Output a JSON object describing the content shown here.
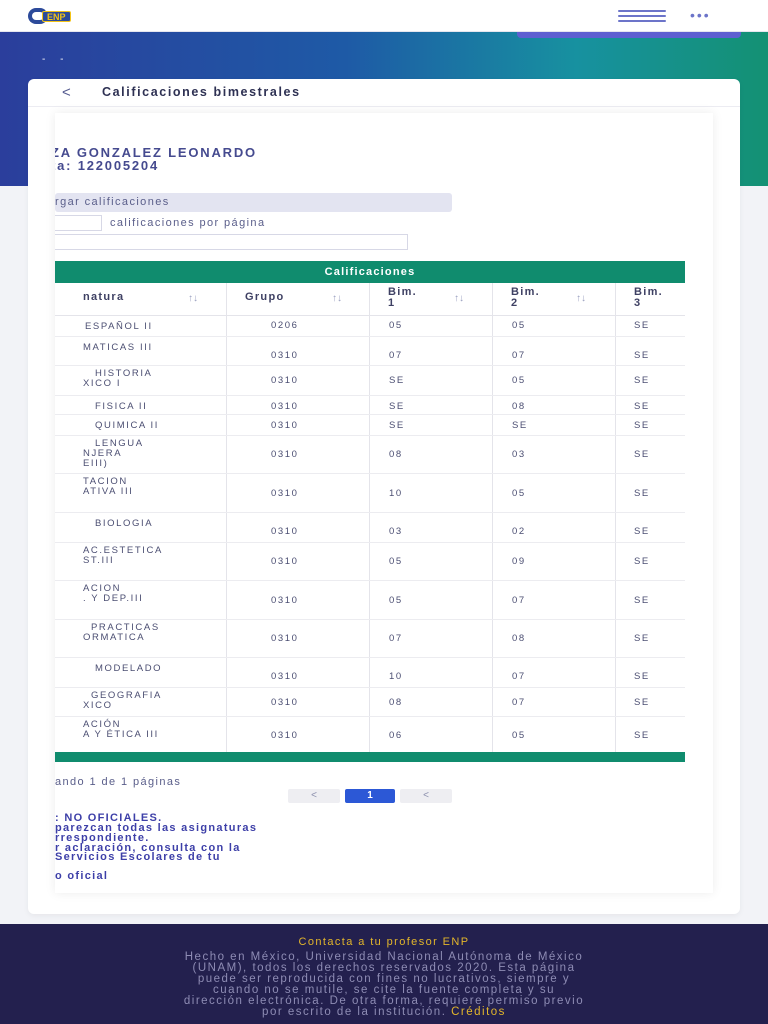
{
  "header": {
    "logo_text": "ENP",
    "accent": "#5e5fd1",
    "menu_icon": "hamburger-icon",
    "more_icon": "dots-icon",
    "more_text": "•••"
  },
  "hero": {
    "dash_text": "- -"
  },
  "page": {
    "back_label": "<",
    "title": "Calificaciones bimestrales"
  },
  "student": {
    "name": "ZA GONZALEZ LEONARDO",
    "account_label": "ta: 122005204"
  },
  "controls": {
    "load_label": "rgar calificaciones",
    "per_page_label": "calificaciones por página"
  },
  "table": {
    "caption": "Calificaciones",
    "headers": [
      "natura",
      "Grupo",
      "Bim.\n1",
      "Bim.\n2",
      "Bim.\n3"
    ],
    "sort_icon": "↑↓",
    "rows": [
      {
        "asignatura": [
          "ESPAÑOL II"
        ],
        "grupo": "0206",
        "bim1": "05",
        "bim2": "05",
        "bim3": "SE"
      },
      {
        "asignatura": [
          "MATICAS III"
        ],
        "grupo": "0310",
        "bim1": "07",
        "bim2": "07",
        "bim3": "SE"
      },
      {
        "asignatura": [
          "HISTORIA",
          "XICO I"
        ],
        "grupo": "0310",
        "bim1": "SE",
        "bim2": "05",
        "bim3": "SE"
      },
      {
        "asignatura": [
          "FISICA II"
        ],
        "grupo": "0310",
        "bim1": "SE",
        "bim2": "08",
        "bim3": "SE"
      },
      {
        "asignatura": [
          "QUIMICA II"
        ],
        "grupo": "0310",
        "bim1": "SE",
        "bim2": "SE",
        "bim3": "SE"
      },
      {
        "asignatura": [
          "LENGUA",
          "NJERA",
          "EIII)"
        ],
        "grupo": "0310",
        "bim1": "08",
        "bim2": "03",
        "bim3": "SE"
      },
      {
        "asignatura": [
          "TACION",
          "ATIVA III"
        ],
        "grupo": "0310",
        "bim1": "10",
        "bim2": "05",
        "bim3": "SE"
      },
      {
        "asignatura": [
          "BIOLOGIA"
        ],
        "grupo": "0310",
        "bim1": "03",
        "bim2": "02",
        "bim3": "SE"
      },
      {
        "asignatura": [
          "AC.ESTETICA",
          "ST.III"
        ],
        "grupo": "0310",
        "bim1": "05",
        "bim2": "09",
        "bim3": "SE"
      },
      {
        "asignatura": [
          "ACION",
          ". Y DEP.III"
        ],
        "grupo": "0310",
        "bim1": "05",
        "bim2": "07",
        "bim3": "SE"
      },
      {
        "asignatura": [
          "PRACTICAS",
          "ORMATICA"
        ],
        "grupo": "0310",
        "bim1": "07",
        "bim2": "08",
        "bim3": "SE"
      },
      {
        "asignatura": [
          "MODELADO"
        ],
        "grupo": "0310",
        "bim1": "10",
        "bim2": "07",
        "bim3": "SE"
      },
      {
        "asignatura": [
          "GEOGRAFIA",
          "XICO"
        ],
        "grupo": "0310",
        "bim1": "08",
        "bim2": "07",
        "bim3": "SE"
      },
      {
        "asignatura": [
          "ACIÓN",
          "A Y ÉTICA III"
        ],
        "grupo": "0310",
        "bim1": "06",
        "bim2": "05",
        "bim3": "SE"
      }
    ]
  },
  "pagination": {
    "info": "ando 1 de 1 páginas",
    "prev": "<",
    "current": "1",
    "next": "<"
  },
  "notes": [
    ": NO OFICIALES.",
    "parezcan todas las asignaturas",
    "rrespondiente.",
    "r aclaración, consulta con la",
    "Servicios Escolares de tu"
  ],
  "oficial_link": "o oficial",
  "footer": {
    "contact": "Contacta a tu profesor ENP",
    "text_lines": [
      "Hecho en México, Universidad Nacional Autónoma de México",
      "(UNAM), todos los derechos reservados 2020. Esta página",
      "puede ser reproducida con fines no lucrativos, siempre y",
      "cuando no se mutile, se cite la fuente completa y su",
      "dirección electrónica. De otra forma, requiere permiso previo",
      "por escrito de la institución."
    ],
    "credits": "Créditos"
  }
}
